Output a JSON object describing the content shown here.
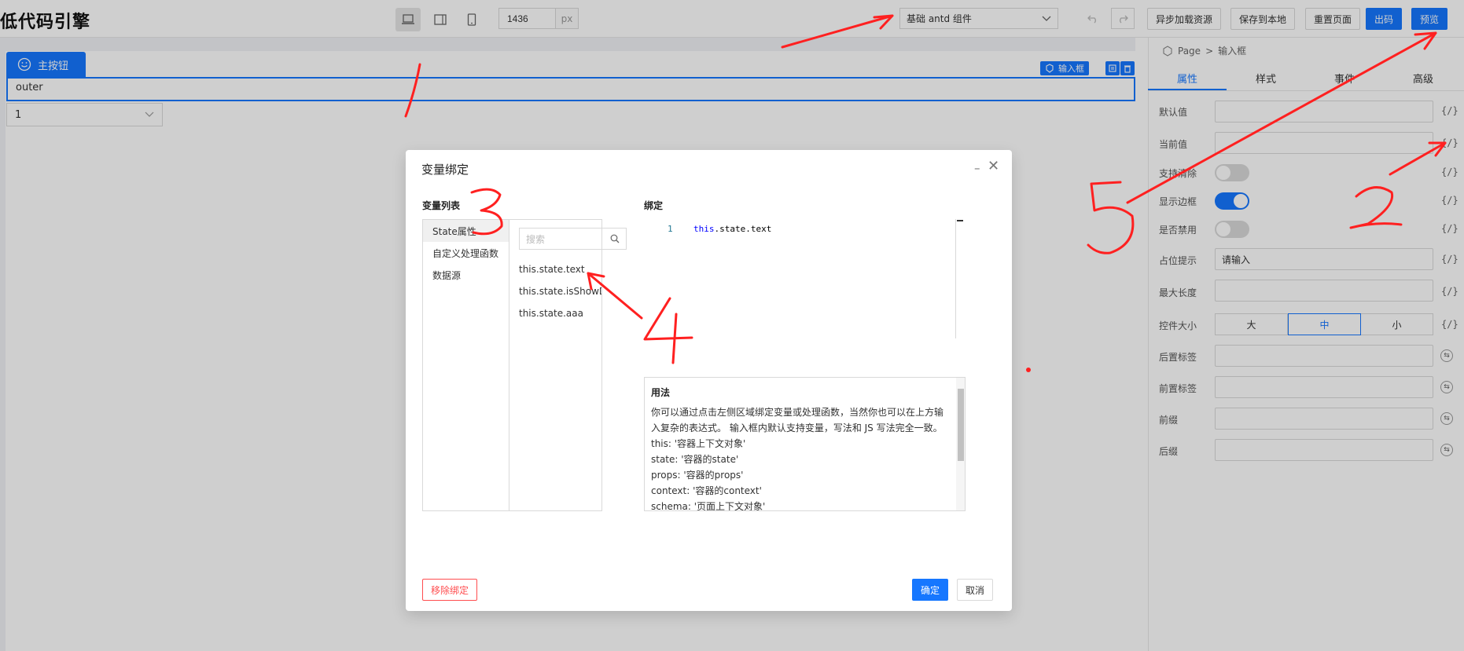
{
  "app": {
    "logo_text": "低代码引擎"
  },
  "toolbar": {
    "width_value": "1436",
    "width_unit": "px",
    "component_select": "基础 antd 组件",
    "async_load": "异步加载资源",
    "save_local": "保存到本地",
    "reset_page": "重置页面",
    "export_code": "出码",
    "preview": "预览"
  },
  "canvas": {
    "main_tab": "主按钮",
    "outer_text": "outer",
    "selected_tag": "输入框",
    "select_value": "1"
  },
  "panel": {
    "breadcrumb": [
      "Page",
      "输入框"
    ],
    "tabs": [
      "属性",
      "样式",
      "事件",
      "高级"
    ],
    "props": {
      "default_value": "默认值",
      "current_value": "当前值",
      "allow_clear": "支持清除",
      "show_border": "显示边框",
      "disabled": "是否禁用",
      "placeholder_label": "占位提示",
      "placeholder_value": "请输入",
      "max_length": "最大长度",
      "size_label": "控件大小",
      "sizes": [
        "大",
        "中",
        "小"
      ],
      "addon_after": "后置标签",
      "addon_before": "前置标签",
      "prefix": "前缀",
      "suffix": "后缀"
    },
    "var_icon": "{/}"
  },
  "modal": {
    "title": "变量绑定",
    "list_heading": "变量列表",
    "bind_heading": "绑定",
    "categories": [
      "State属性",
      "自定义处理函数",
      "数据源"
    ],
    "search_placeholder": "搜索",
    "variables": [
      "this.state.text",
      "this.state.isShowDialog",
      "this.state.aaa"
    ],
    "line_number": "1",
    "code_kw": "this",
    "code_rest": ".state.text",
    "usage_title": "用法",
    "usage_lines": [
      "你可以通过点击左侧区域绑定变量或处理函数，当然你也可以在上方输入复杂的表达式。 输入框内默认支持变量，写法和 JS 写法完全一致。",
      "this: '容器上下文对象'",
      "state: '容器的state'",
      "props: '容器的props'",
      "context: '容器的context'",
      "schema: '页面上下文对象'"
    ],
    "remove_binding": "移除绑定",
    "confirm": "确定",
    "cancel": "取消"
  },
  "annotations": [
    "1",
    "2",
    "3",
    "4",
    "5"
  ],
  "colors": {
    "primary": "#1677ff",
    "danger": "#ff4d4f",
    "annotation": "#ff2020"
  }
}
